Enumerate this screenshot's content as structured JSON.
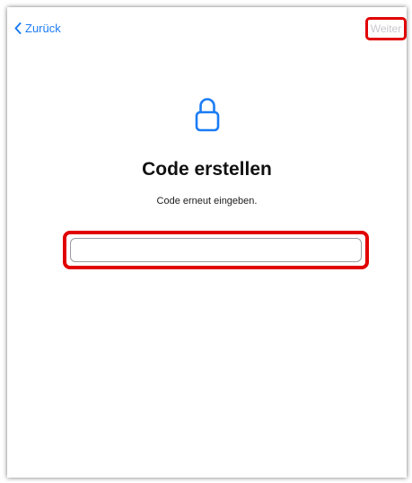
{
  "nav": {
    "back_label": "Zurück",
    "next_label": "Weiter"
  },
  "main": {
    "icon": "lock-icon",
    "title": "Code erstellen",
    "subtitle": "Code erneut eingeben.",
    "code_field": {
      "value": "",
      "placeholder": ""
    }
  },
  "colors": {
    "accent": "#1a7cf5",
    "highlight": "#e10000",
    "disabled_text": "#c9c9cf"
  }
}
